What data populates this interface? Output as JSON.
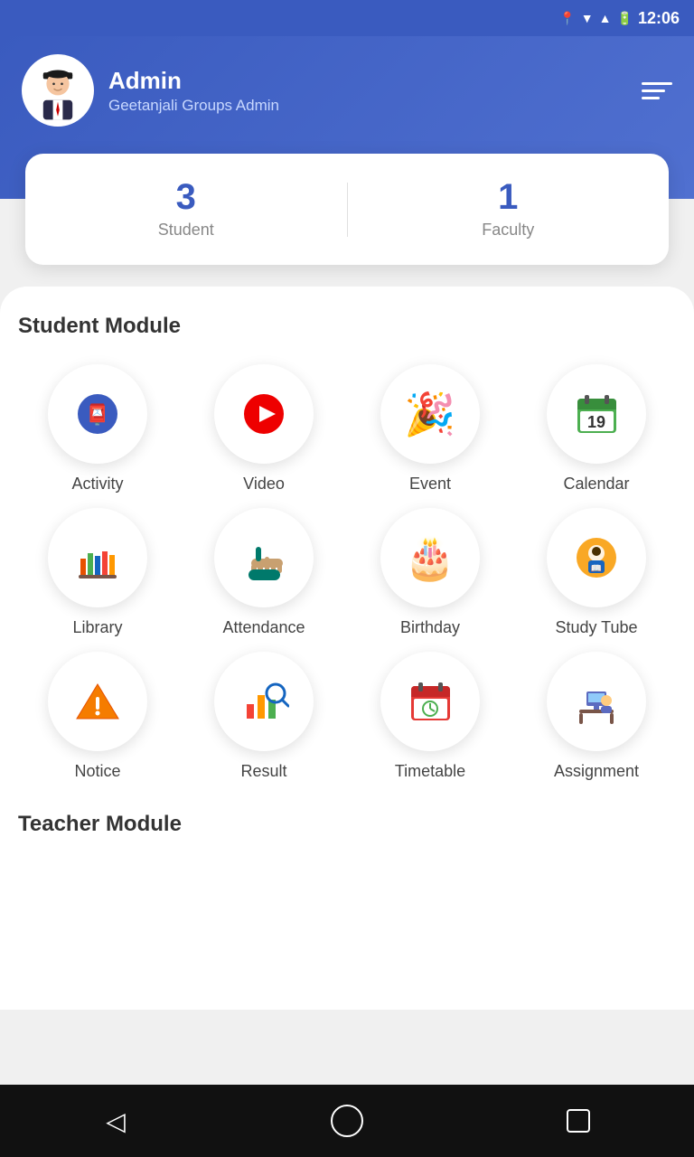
{
  "status_bar": {
    "time": "12:06",
    "icons": [
      "location",
      "wifi",
      "signal",
      "battery"
    ]
  },
  "header": {
    "admin_name": "Admin",
    "admin_subtitle": "Geetanjali Groups Admin",
    "menu_icon": "☰"
  },
  "stats": {
    "student_count": "3",
    "student_label": "Student",
    "faculty_count": "1",
    "faculty_label": "Faculty"
  },
  "student_module": {
    "title": "Student Module",
    "items": [
      {
        "id": "activity",
        "label": "Activity",
        "emoji": "📌",
        "color": "#3a5bbf"
      },
      {
        "id": "video",
        "label": "Video",
        "emoji": "▶️",
        "color": "#e00"
      },
      {
        "id": "event",
        "label": "Event",
        "emoji": "🎉",
        "color": "#ff6699"
      },
      {
        "id": "calendar",
        "label": "Calendar",
        "emoji": "📅",
        "color": "#2e7d32"
      },
      {
        "id": "library",
        "label": "Library",
        "emoji": "📚",
        "color": "#e65100"
      },
      {
        "id": "attendance",
        "label": "Attendance",
        "emoji": "✋",
        "color": "#00796b"
      },
      {
        "id": "birthday",
        "label": "Birthday",
        "emoji": "🎂",
        "color": "#f44336"
      },
      {
        "id": "study-tube",
        "label": "Study Tube",
        "emoji": "👨‍🎓",
        "color": "#f9a825"
      },
      {
        "id": "notice",
        "label": "Notice",
        "emoji": "⚠️",
        "color": "#f57c00"
      },
      {
        "id": "result",
        "label": "Result",
        "emoji": "🔍",
        "color": "#1565c0"
      },
      {
        "id": "timetable",
        "label": "Timetable",
        "emoji": "📆",
        "color": "#2e7d32"
      },
      {
        "id": "assignment",
        "label": "Assignment",
        "emoji": "🖥️",
        "color": "#5c6bc0"
      }
    ]
  },
  "teacher_module": {
    "title": "Teacher Module"
  },
  "bottom_nav": {
    "back": "◁",
    "home": "○",
    "recent": "□"
  }
}
